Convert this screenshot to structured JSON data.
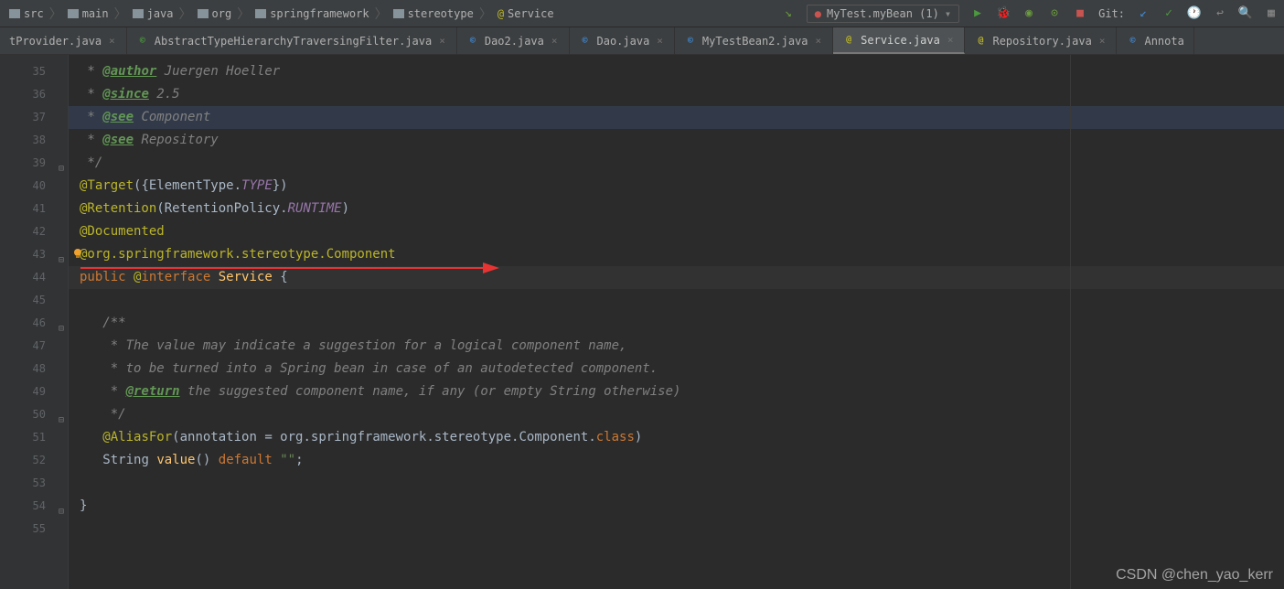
{
  "breadcrumb": [
    {
      "icon": "folder",
      "label": "src"
    },
    {
      "icon": "folder",
      "label": "main"
    },
    {
      "icon": "folder",
      "label": "java"
    },
    {
      "icon": "folder",
      "label": "org"
    },
    {
      "icon": "folder",
      "label": "springframework"
    },
    {
      "icon": "folder",
      "label": "stereotype"
    },
    {
      "icon": "annotation",
      "label": "Service"
    }
  ],
  "runConfig": {
    "label": "MyTest.myBean (1)"
  },
  "gitLabel": "Git:",
  "tabs": [
    {
      "label": "tProvider.java",
      "icon": "class"
    },
    {
      "label": "AbstractTypeHierarchyTraversingFilter.java",
      "icon": "filter"
    },
    {
      "label": "Dao2.java",
      "icon": "class"
    },
    {
      "label": "Dao.java",
      "icon": "class"
    },
    {
      "label": "MyTestBean2.java",
      "icon": "class"
    },
    {
      "label": "Service.java",
      "icon": "annotation",
      "active": true
    },
    {
      "label": "Repository.java",
      "icon": "annotation"
    },
    {
      "label": "Annota",
      "icon": "class"
    }
  ],
  "lineNumbers": [
    "35",
    "36",
    "37",
    "38",
    "39",
    "40",
    "41",
    "42",
    "43",
    "44",
    "45",
    "46",
    "47",
    "48",
    "49",
    "50",
    "51",
    "52",
    "53",
    "54",
    "55"
  ],
  "code": {
    "l35_author": "@author",
    "l35_text": " Juergen Hoeller",
    "l36_since": "@since",
    "l36_text": " 2.5",
    "l37_see": "@see",
    "l37_text": " Component",
    "l38_see": "@see",
    "l38_text": " Repository",
    "l39": " */",
    "l40_ann": "@Target",
    "l40_rest1": "({ElementType.",
    "l40_type": "TYPE",
    "l40_rest2": "})",
    "l41_ann": "@Retention",
    "l41_rest1": "(RetentionPolicy.",
    "l41_type": "RUNTIME",
    "l41_rest2": ")",
    "l42_ann": "@Documented",
    "l43_ann": "@org.springframework.stereotype.Component",
    "l44_kw1": "public ",
    "l44_at": "@",
    "l44_kw2": "interface ",
    "l44_name": "Service",
    "l44_brace": " {",
    "l46": "   /**",
    "l47": "    * The value may indicate a suggestion for a logical component name,",
    "l48": "    * to be turned into a Spring bean in case of an autodetected component.",
    "l49_pre": "    * ",
    "l49_tag": "@return",
    "l49_text": " the suggested component name, if any (or empty String otherwise)",
    "l50": "    */",
    "l51_ann": "@AliasFor",
    "l51_p1": "(",
    "l51_attr": "annotation ",
    "l51_eq": "= org.springframework.stereotype.Component.",
    "l51_cls": "class",
    "l51_p2": ")",
    "l52_type": "String ",
    "l52_name": "value",
    "l52_p": "() ",
    "l52_kw": "default ",
    "l52_str": "\"\"",
    "l52_end": ";",
    "l54": "}"
  },
  "watermark": "CSDN @chen_yao_kerr"
}
